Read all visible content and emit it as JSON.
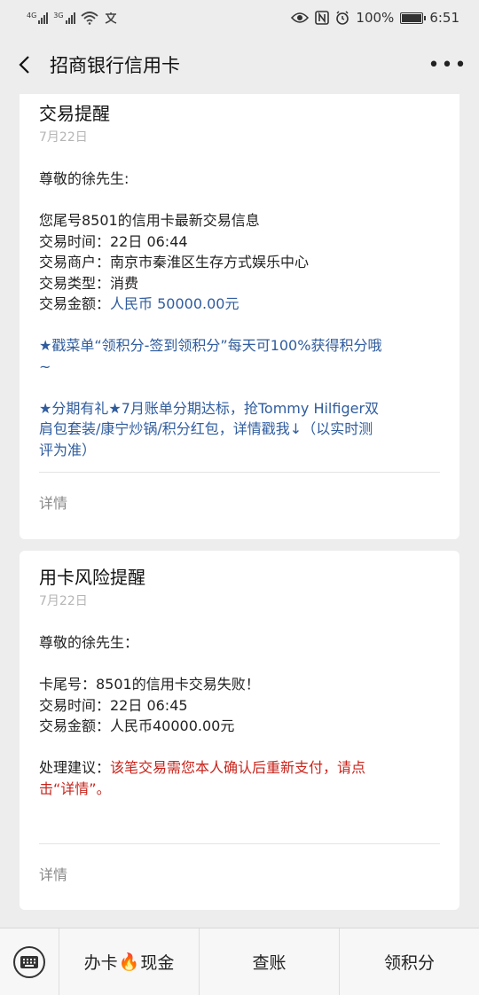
{
  "status": {
    "net1": "4G",
    "net2": "3G",
    "battery": "100%",
    "time": "6:51"
  },
  "header": {
    "title": "招商银行信用卡"
  },
  "messages": [
    {
      "title": "交易提醒",
      "date": "7月22日",
      "greeting": "尊敬的徐先生:",
      "intro": "您尾号8501的信用卡最新交易信息",
      "time": "交易时间：22日 06:44",
      "merchant": "交易商户：南京市秦淮区生存方式娱乐中心",
      "type": "交易类型：消费",
      "amount_label": "交易金额：",
      "amount_value": "人民币 50000.00元",
      "promo1_l1": "★戳菜单“领积分-签到领积分”每天可100%获得积分哦",
      "promo1_l2": "~",
      "promo2_l1": "★分期有礼★7月账单分期达标，抢Tommy Hilfiger双",
      "promo2_l2": "肩包套装/康宁炒锅/积分红包，详情戳我↓（以实时测",
      "promo2_l3": "评为准）",
      "detail": "详情"
    },
    {
      "title": "用卡风险提醒",
      "date": "7月22日",
      "greeting": "尊敬的徐先生：",
      "intro": "卡尾号：8501的信用卡交易失败！",
      "time": "交易时间：22日 06:45",
      "amount": "交易金额：人民币40000.00元",
      "advice_label": "处理建议：",
      "advice_l1": "该笔交易需您本人确认后重新支付，请点",
      "advice_l2": "击“详情”。",
      "detail": "详情"
    }
  ],
  "menu": {
    "item1_a": "办卡",
    "item1_icon": "🔥",
    "item1_b": "现金",
    "item2": "查账",
    "item3": "领积分"
  },
  "colors": {
    "link_blue": "#2f5c9e",
    "warning_red": "#c8241c"
  }
}
